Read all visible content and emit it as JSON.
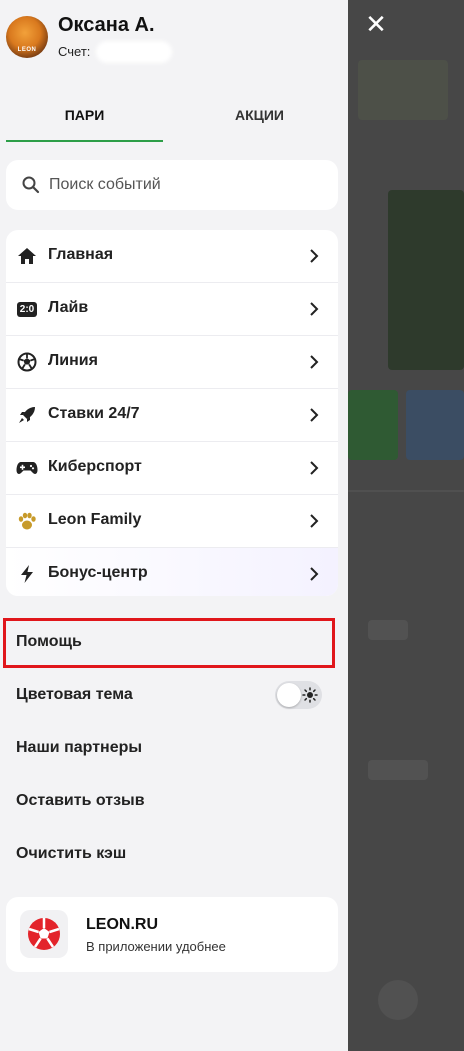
{
  "user": {
    "name": "Оксана А.",
    "account_label": "Счет:",
    "avatar_logo": "LEON"
  },
  "tabs": [
    {
      "label": "ПАРИ",
      "active": true
    },
    {
      "label": "АКЦИИ",
      "active": false
    }
  ],
  "search": {
    "placeholder": "Поиск событий"
  },
  "menu": [
    {
      "label": "Главная",
      "icon": "home-icon"
    },
    {
      "label": "Лайв",
      "icon": "live-score-icon",
      "icon_text": "2:0"
    },
    {
      "label": "Линия",
      "icon": "soccer-ball-icon"
    },
    {
      "label": "Ставки 24/7",
      "icon": "rocket-icon"
    },
    {
      "label": "Киберспорт",
      "icon": "gamepad-icon"
    },
    {
      "label": "Leon Family",
      "icon": "paw-icon"
    },
    {
      "label": "Бонус-центр",
      "icon": "lightning-icon"
    }
  ],
  "links": {
    "help": "Помощь",
    "theme": "Цветовая тема",
    "partners": "Наши партнеры",
    "feedback": "Оставить отзыв",
    "clear_cache": "Очистить кэш"
  },
  "theme_toggle": {
    "state": "light",
    "icon": "sun-icon"
  },
  "app_promo": {
    "title": "LEON.RU",
    "subtitle": "В приложении удобнее"
  },
  "close": {
    "label": "✕",
    "icon": "close-icon"
  },
  "colors": {
    "accent": "#2d9e48",
    "highlight": "#e0161b",
    "backdrop": "#474747",
    "brand_red": "#e3242b"
  }
}
